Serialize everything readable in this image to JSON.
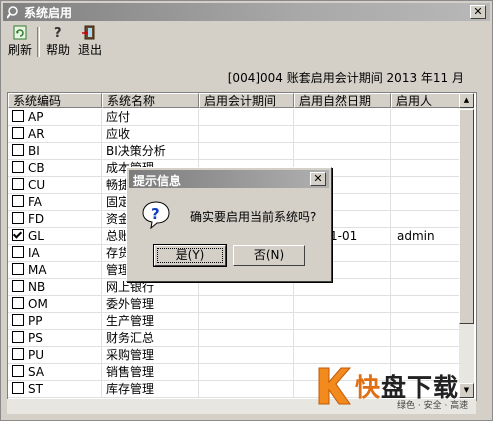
{
  "window": {
    "title": "系统启用",
    "close": "✕"
  },
  "toolbar": {
    "refresh": "刷新",
    "help": "帮助",
    "exit": "退出"
  },
  "period_text": "[004]004 账套启用会计期间 2013 年11 月",
  "table": {
    "columns": [
      "系统编码",
      "系统名称",
      "启用会计期间",
      "启用自然日期",
      "启用人"
    ],
    "rows": [
      {
        "code": "AP",
        "name": "应付",
        "period": "",
        "date": "",
        "user": "",
        "checked": false
      },
      {
        "code": "AR",
        "name": "应收",
        "period": "",
        "date": "",
        "user": "",
        "checked": false
      },
      {
        "code": "BI",
        "name": "BI决策分析",
        "period": "",
        "date": "",
        "user": "",
        "checked": false
      },
      {
        "code": "CB",
        "name": "成本管理",
        "period": "",
        "date": "",
        "user": "",
        "checked": false
      },
      {
        "code": "CU",
        "name": "畅捷",
        "period": "",
        "date": "",
        "user": "",
        "checked": false
      },
      {
        "code": "FA",
        "name": "固定",
        "period": "",
        "date": "",
        "user": "",
        "checked": false
      },
      {
        "code": "FD",
        "name": "资金",
        "period": "",
        "date": "",
        "user": "",
        "checked": false
      },
      {
        "code": "GL",
        "name": "总账",
        "period": "",
        "date": "1-01",
        "user": "admin",
        "checked": true
      },
      {
        "code": "IA",
        "name": "存货",
        "period": "",
        "date": "",
        "user": "",
        "checked": false
      },
      {
        "code": "MA",
        "name": "管理",
        "period": "",
        "date": "",
        "user": "",
        "checked": false
      },
      {
        "code": "NB",
        "name": "网上银行",
        "period": "",
        "date": "",
        "user": "",
        "checked": false
      },
      {
        "code": "OM",
        "name": "委外管理",
        "period": "",
        "date": "",
        "user": "",
        "checked": false
      },
      {
        "code": "PP",
        "name": "生产管理",
        "period": "",
        "date": "",
        "user": "",
        "checked": false
      },
      {
        "code": "PS",
        "name": "财务汇总",
        "period": "",
        "date": "",
        "user": "",
        "checked": false
      },
      {
        "code": "PU",
        "name": "采购管理",
        "period": "",
        "date": "",
        "user": "",
        "checked": false
      },
      {
        "code": "SA",
        "name": "销售管理",
        "period": "",
        "date": "",
        "user": "",
        "checked": false
      },
      {
        "code": "ST",
        "name": "库存管理",
        "period": "",
        "date": "",
        "user": "",
        "checked": false
      }
    ]
  },
  "dialog": {
    "title": "提示信息",
    "close": "✕",
    "message": "确实要启用当前系统吗?",
    "yes": "是(Y)",
    "no": "否(N)"
  },
  "scroll": {
    "up": "▲",
    "down": "▼"
  },
  "watermark": {
    "brand_fast": "快",
    "brand_rest": "盘下载",
    "tagline": "绿色 · 安全 · 高速"
  }
}
